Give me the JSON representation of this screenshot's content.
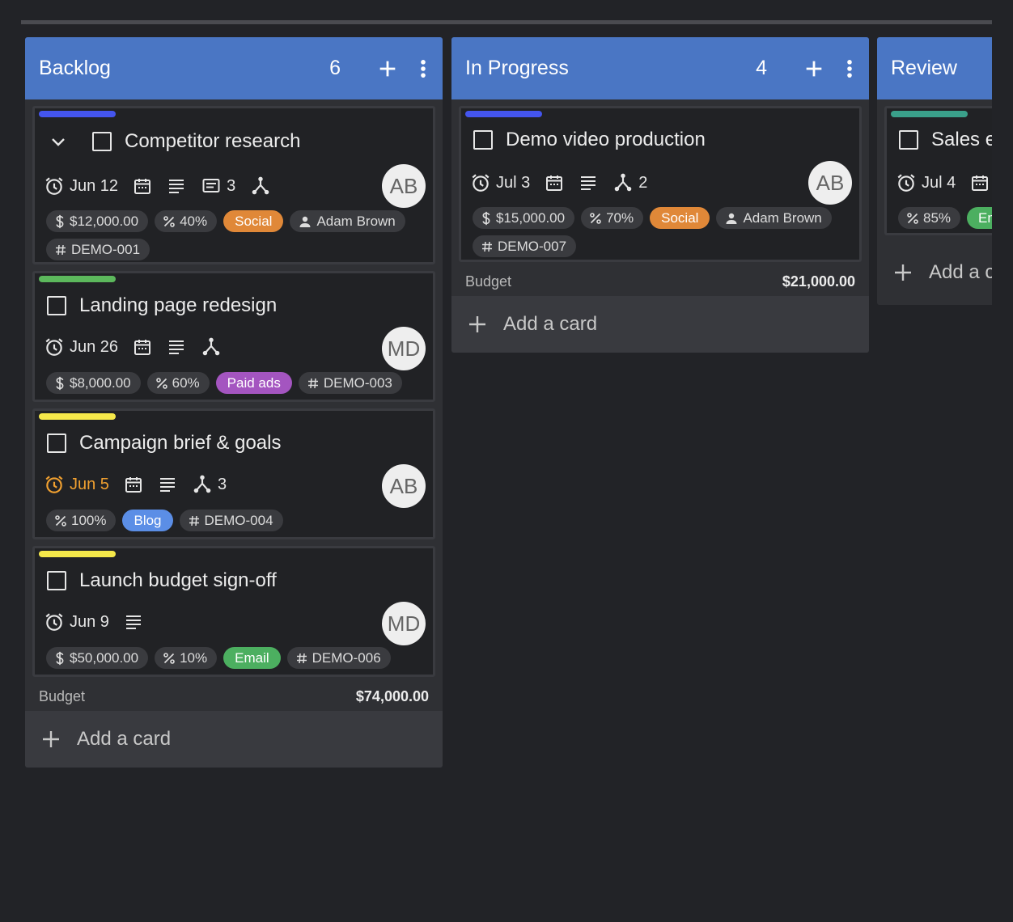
{
  "columns": [
    {
      "title": "Backlog",
      "count": "6",
      "footer": {
        "label": "Budget",
        "value": "$74,000.00"
      },
      "add_card_label": "Add a card",
      "cards": [
        {
          "stripe_color": "#4455ee",
          "title": "Competitor research",
          "due": "Jun 12",
          "comments": "3",
          "subtasks": "",
          "avatar": "AB",
          "budget": "$12,000.00",
          "progress": "40%",
          "tag": "Social",
          "tag_color": "#e08838",
          "assignee": "Adam Brown",
          "id": "DEMO-001"
        },
        {
          "stripe_color": "#5cb85c",
          "title": "Landing page redesign",
          "due": "Jun 26",
          "subtasks": "",
          "avatar": "MD",
          "budget": "$8,000.00",
          "progress": "60%",
          "tag": "Paid ads",
          "tag_color": "#a455c0",
          "id": "DEMO-003"
        },
        {
          "stripe_color": "#f5e84a",
          "title": "Campaign brief & goals",
          "due": "Jun 5",
          "due_color": "#f0a030",
          "subtasks": "3",
          "avatar": "AB",
          "progress": "100%",
          "tag": "Blog",
          "tag_color": "#5b8ee6",
          "id": "DEMO-004"
        },
        {
          "stripe_color": "#f5e84a",
          "title": "Launch budget sign-off",
          "due": "Jun 9",
          "avatar": "MD",
          "budget": "$50,000.00",
          "progress": "10%",
          "tag": "Email",
          "tag_color": "#4caf60",
          "id": "DEMO-006"
        }
      ]
    },
    {
      "title": "In Progress",
      "count": "4",
      "footer": {
        "label": "Budget",
        "value": "$21,000.00"
      },
      "add_card_label": "Add a card",
      "cards": [
        {
          "stripe_color": "#4455ee",
          "title": "Demo video production",
          "due": "Jul 3",
          "subtasks": "2",
          "avatar": "AB",
          "budget": "$15,000.00",
          "progress": "70%",
          "tag": "Social",
          "tag_color": "#e08838",
          "assignee": "Adam Brown",
          "id": "DEMO-007"
        }
      ]
    },
    {
      "title": "Review",
      "add_card_label": "Add a c",
      "cards": [
        {
          "stripe_color": "#3aa08a",
          "title": "Sales e",
          "due": "Jul 4",
          "progress": "85%",
          "tag": "Em",
          "tag_color": "#4caf60"
        }
      ]
    }
  ]
}
